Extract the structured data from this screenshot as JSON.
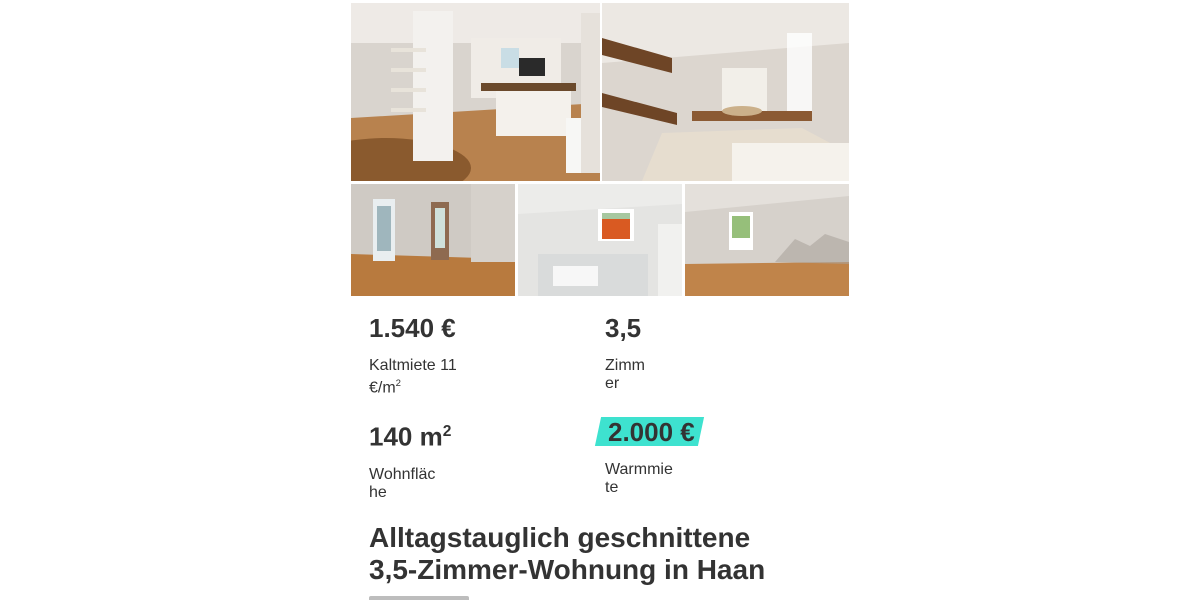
{
  "listing": {
    "price": "1.540 €",
    "price_label": "Kaltmiete 11 €/m",
    "price_label_sup": "2",
    "rooms": "3,5",
    "rooms_label": "Zimmer",
    "area": "140 m",
    "area_sup": "2",
    "area_label": "Wohnfläche",
    "warm_rent": "2.000 €",
    "warm_rent_label": "Warmmiete",
    "title": "Alltagstauglich geschnittene 3,5-Zimmer-Wohnung in Haan"
  },
  "colors": {
    "highlight": "#3ee2cf",
    "text": "#333333"
  },
  "gallery": {
    "photos": [
      "living-room-with-spiral-staircase",
      "kitchen-with-wall-shelves",
      "empty-room-with-doorway",
      "tiled-bathroom-with-tub",
      "empty-room-with-window"
    ]
  }
}
